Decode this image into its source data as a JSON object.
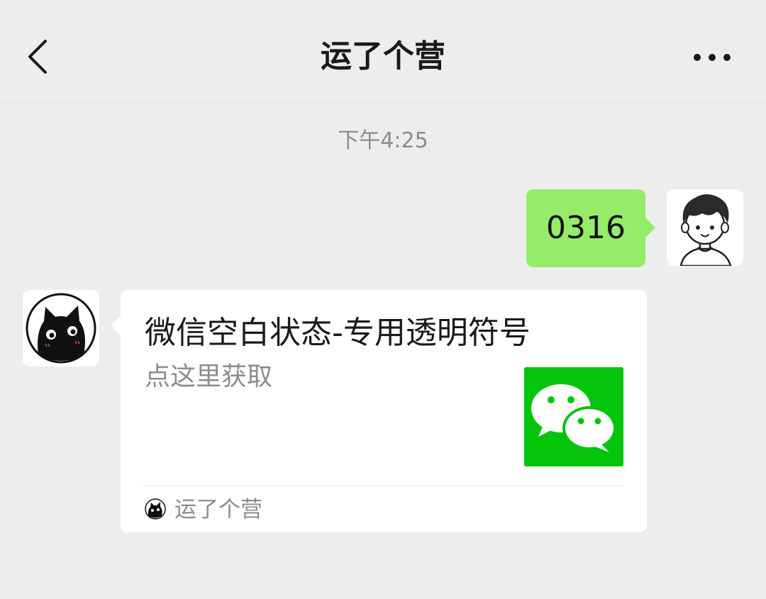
{
  "header": {
    "title": "运了个营",
    "back_icon": "chevron-left-icon",
    "more_icon": "more-dots-icon"
  },
  "chat": {
    "timestamp": "下午4:25",
    "sent_message": {
      "text": "0316",
      "bubble_color": "#95ec69"
    },
    "link_card": {
      "title": "微信空白状态-专用透明符号",
      "description": "点这里获取",
      "thumbnail_icon": "wechat-logo-icon",
      "thumbnail_color": "#04c40c",
      "source_name": "运了个营"
    }
  },
  "colors": {
    "background": "#ededed",
    "card": "#ffffff",
    "secondary_text": "#8c8c8c"
  }
}
